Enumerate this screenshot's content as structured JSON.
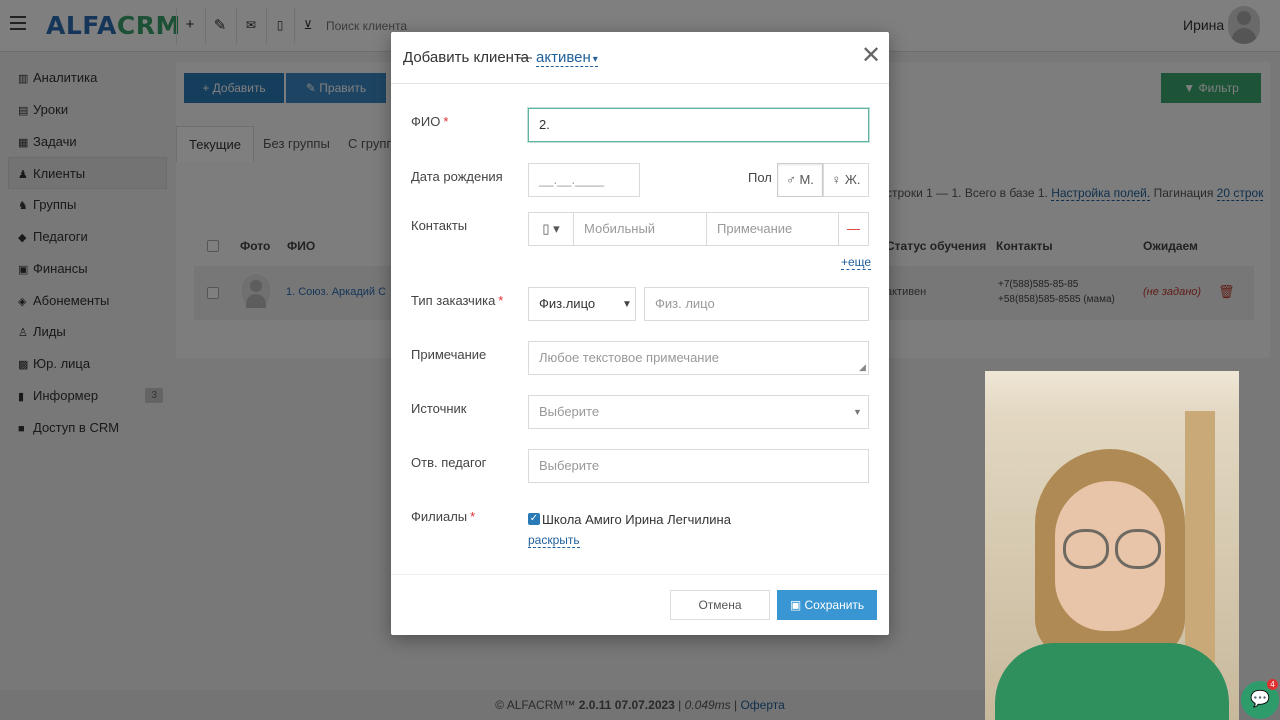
{
  "app": {
    "logo_part1": "ALFA",
    "logo_part2": "CRM"
  },
  "topbar": {
    "search_placeholder": "Поиск клиента",
    "user_name": "Ирина",
    "icons": [
      "menu-icon",
      "plus-icon",
      "wrench-icon",
      "mail-icon",
      "phone-icon",
      "cart-icon"
    ]
  },
  "sidebar": {
    "items": [
      {
        "label": "Аналитика",
        "icon": "chart-icon"
      },
      {
        "label": "Уроки",
        "icon": "calendar-icon"
      },
      {
        "label": "Задачи",
        "icon": "tasks-icon"
      },
      {
        "label": "Клиенты",
        "icon": "user-icon",
        "active": true
      },
      {
        "label": "Группы",
        "icon": "group-icon"
      },
      {
        "label": "Педагоги",
        "icon": "graduation-icon"
      },
      {
        "label": "Финансы",
        "icon": "money-icon"
      },
      {
        "label": "Абонементы",
        "icon": "tag-icon"
      },
      {
        "label": "Лиды",
        "icon": "lead-icon"
      },
      {
        "label": "Юр. лица",
        "icon": "briefcase-icon"
      },
      {
        "label": "Информер",
        "icon": "informer-icon",
        "badge": "3"
      },
      {
        "label": "Доступ в CRM",
        "icon": "lock-icon"
      }
    ]
  },
  "toolbar": {
    "add_label": "+ Добавить",
    "edit_label": "✎ Править",
    "filter_label": "▼ Фильтр"
  },
  "tabs": [
    "Текущие",
    "Без группы",
    "С группы"
  ],
  "paging": {
    "prefix": "строки 1 — 1. Всего в базе 1.",
    "settings_link": "Настройка полей.",
    "pagination_label": "Пагинация",
    "pagination_link": "20 строк"
  },
  "table": {
    "headers": {
      "photo": "Фото",
      "name": "ФИО",
      "status": "Статус обучения",
      "contacts": "Контакты",
      "awaiting": "Ожидаем"
    },
    "row": {
      "name": "1. Союз. Аркадий С",
      "status": "активен",
      "phone1": "+7(588)585-85-85",
      "phone2": "+58(858)585-8585 (мама)",
      "awaiting": "(не задано)"
    }
  },
  "modal": {
    "title": "Добавить клиента",
    "dash": "—",
    "status": "активен",
    "fields": {
      "fio_label": "ФИО",
      "fio_value": "2.",
      "birth_label": "Дата рождения",
      "birth_placeholder": "__.__.____",
      "gender_label": "Пол",
      "gender_m": "М.",
      "gender_f": "Ж.",
      "contacts_label": "Контакты",
      "mobile_placeholder": "Мобильный",
      "note_placeholder": "Примечание",
      "more_link": "+еще",
      "customer_type_label": "Тип заказчика",
      "customer_type_value": "Физ.лицо",
      "customer_type_placeholder": "Физ. лицо",
      "comment_label": "Примечание",
      "comment_placeholder": "Любое текстовое примечание",
      "source_label": "Источник",
      "source_placeholder": "Выберите",
      "teacher_label": "Отв. педагог",
      "teacher_placeholder": "Выберите",
      "branches_label": "Филиалы",
      "branch_name": "Школа Амиго Ирина Легчилина",
      "expand_link": "раскрыть"
    },
    "required_mark": "*",
    "cancel_label": "Отмена",
    "save_label": "Сохранить"
  },
  "footer": {
    "copyright": "© ALFACRM™",
    "version": "2.0.11",
    "date": "07.07.2023",
    "timing": "0.049ms",
    "offer": "Оферта"
  },
  "chat": {
    "badge": "4"
  },
  "colors": {
    "brand_blue": "#2b6cb0",
    "brand_green": "#3aa36b",
    "save": "#3a95d3",
    "required": "#e03131"
  }
}
